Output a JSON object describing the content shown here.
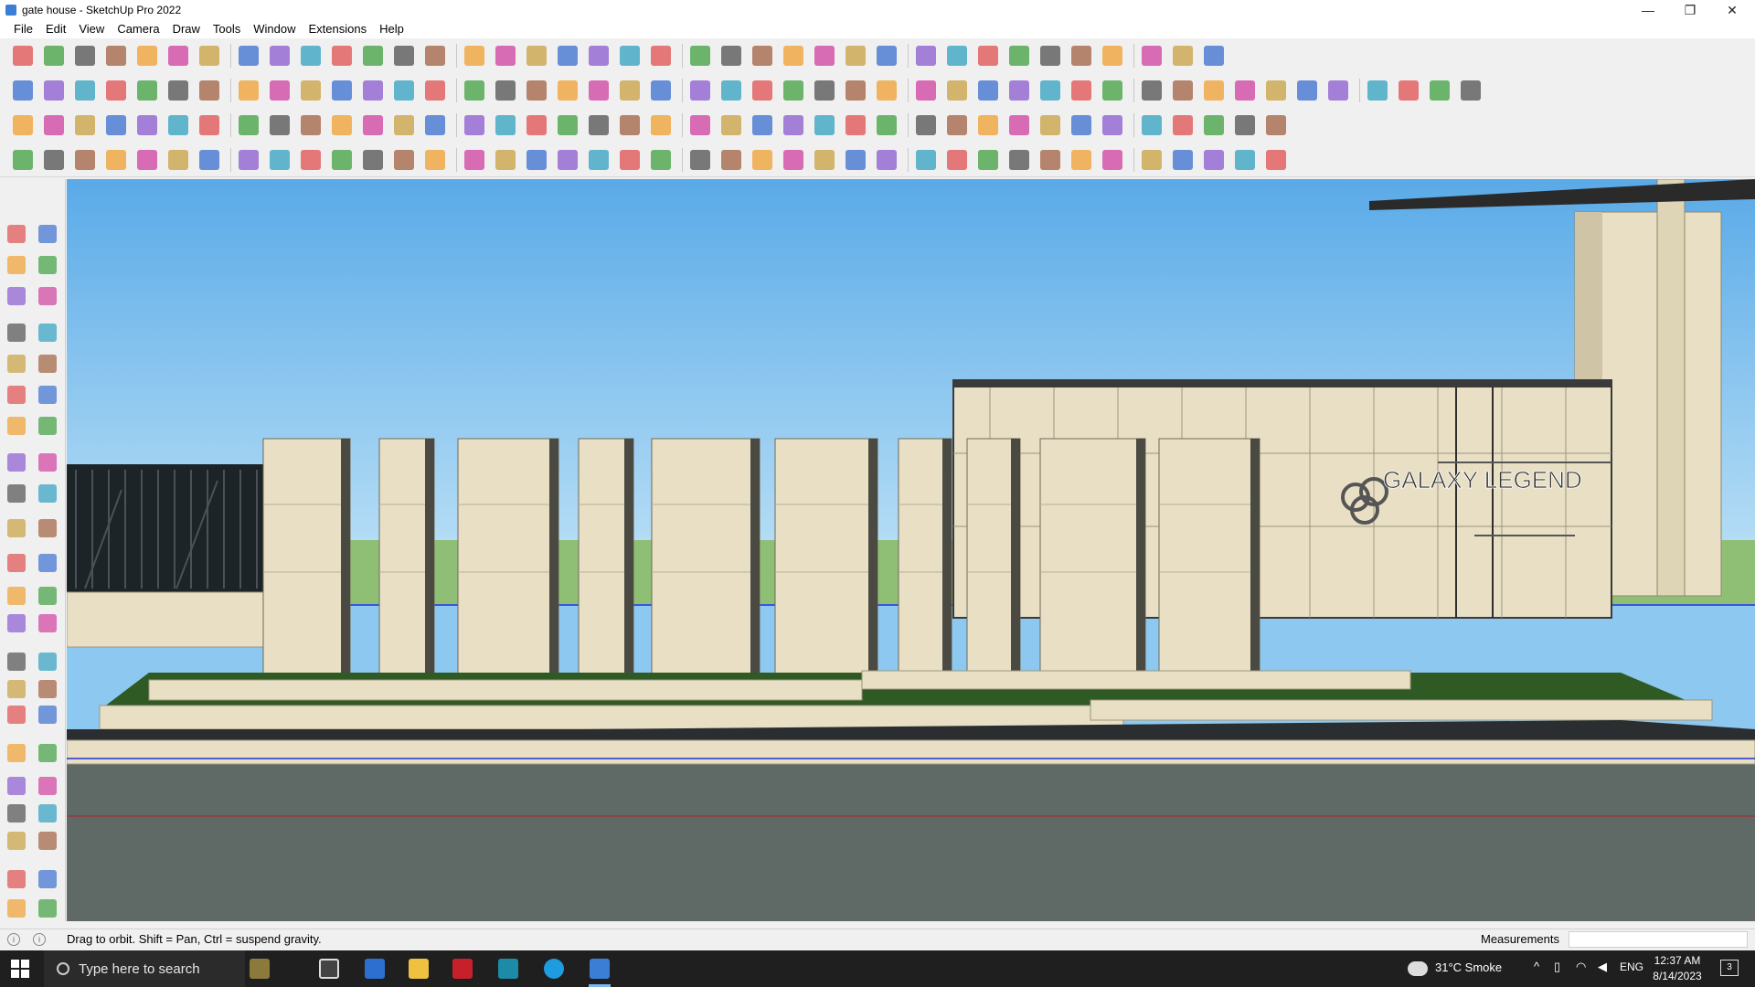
{
  "window": {
    "title": "gate house - SketchUp Pro 2022",
    "app_icon": "sketchup-icon"
  },
  "window_controls": [
    {
      "name": "minimize-icon",
      "glyph": "—"
    },
    {
      "name": "restore-icon",
      "glyph": "❐"
    },
    {
      "name": "close-icon",
      "glyph": "✕"
    }
  ],
  "menu": [
    "File",
    "Edit",
    "View",
    "Camera",
    "Draw",
    "Tools",
    "Window",
    "Extensions",
    "Help"
  ],
  "scene": {
    "sign_text": "GALAXY LEGEND",
    "sign_logo": "GGG",
    "colors": {
      "sky_top": "#5aaae8",
      "sky_bottom": "#bfe3f7",
      "stone": "#e8dfc4",
      "stone_shadow": "#cfc5a6",
      "grass": "#2f5a23",
      "ground": "#5f6a66",
      "fence": "#1d2428",
      "road": "#2b2e30"
    }
  },
  "status": {
    "hint": "Drag to orbit. Shift = Pan, Ctrl = suspend gravity.",
    "measurements_label": "Measurements",
    "measurements_value": ""
  },
  "taskbar": {
    "search_placeholder": "Type here to search",
    "weather": "31°C  Smoke",
    "language": "ENG",
    "time": "12:37 AM",
    "date": "8/14/2023",
    "notification_count": "3"
  }
}
